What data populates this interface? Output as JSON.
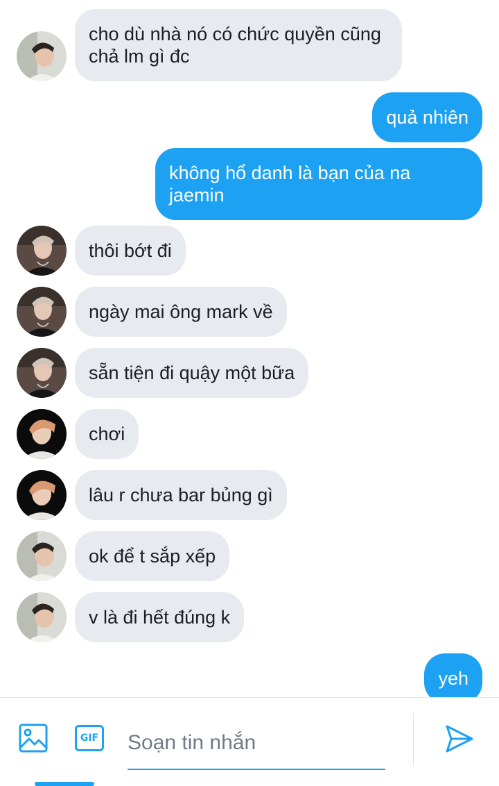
{
  "thread": {
    "messages": [
      {
        "dir": "in",
        "text": "cho dù nhà nó có chức quyền cũng chả lm gì đc",
        "avatar": "avatar-a"
      },
      {
        "dir": "out",
        "text": "quả nhiên"
      },
      {
        "dir": "out",
        "text": "không hổ danh là bạn của na jaemin"
      },
      {
        "dir": "in",
        "text": "thôi bớt đi",
        "avatar": "avatar-b"
      },
      {
        "dir": "in",
        "text": "ngày mai ông mark về",
        "avatar": "avatar-b"
      },
      {
        "dir": "in",
        "text": "sẵn tiện đi quậy một bữa",
        "avatar": "avatar-b"
      },
      {
        "dir": "in",
        "text": "chơi",
        "avatar": "avatar-c"
      },
      {
        "dir": "in",
        "text": "lâu r chưa bar bủng gì",
        "avatar": "avatar-c"
      },
      {
        "dir": "in",
        "text": "ok để t sắp xếp",
        "avatar": "avatar-a"
      },
      {
        "dir": "in",
        "text": "v là đi hết đúng k",
        "avatar": "avatar-a"
      },
      {
        "dir": "out",
        "text": "yeh"
      }
    ]
  },
  "composer": {
    "placeholder": "Soạn tin nhắn",
    "value": "",
    "gif_label": "GIF",
    "icons": [
      "image-icon",
      "gif-icon",
      "send-icon"
    ]
  },
  "colors": {
    "accent": "#1da1f2",
    "incoming_bubble": "#e7eaee",
    "incoming_text": "#1a1f24",
    "outgoing_text": "#ffffff"
  }
}
